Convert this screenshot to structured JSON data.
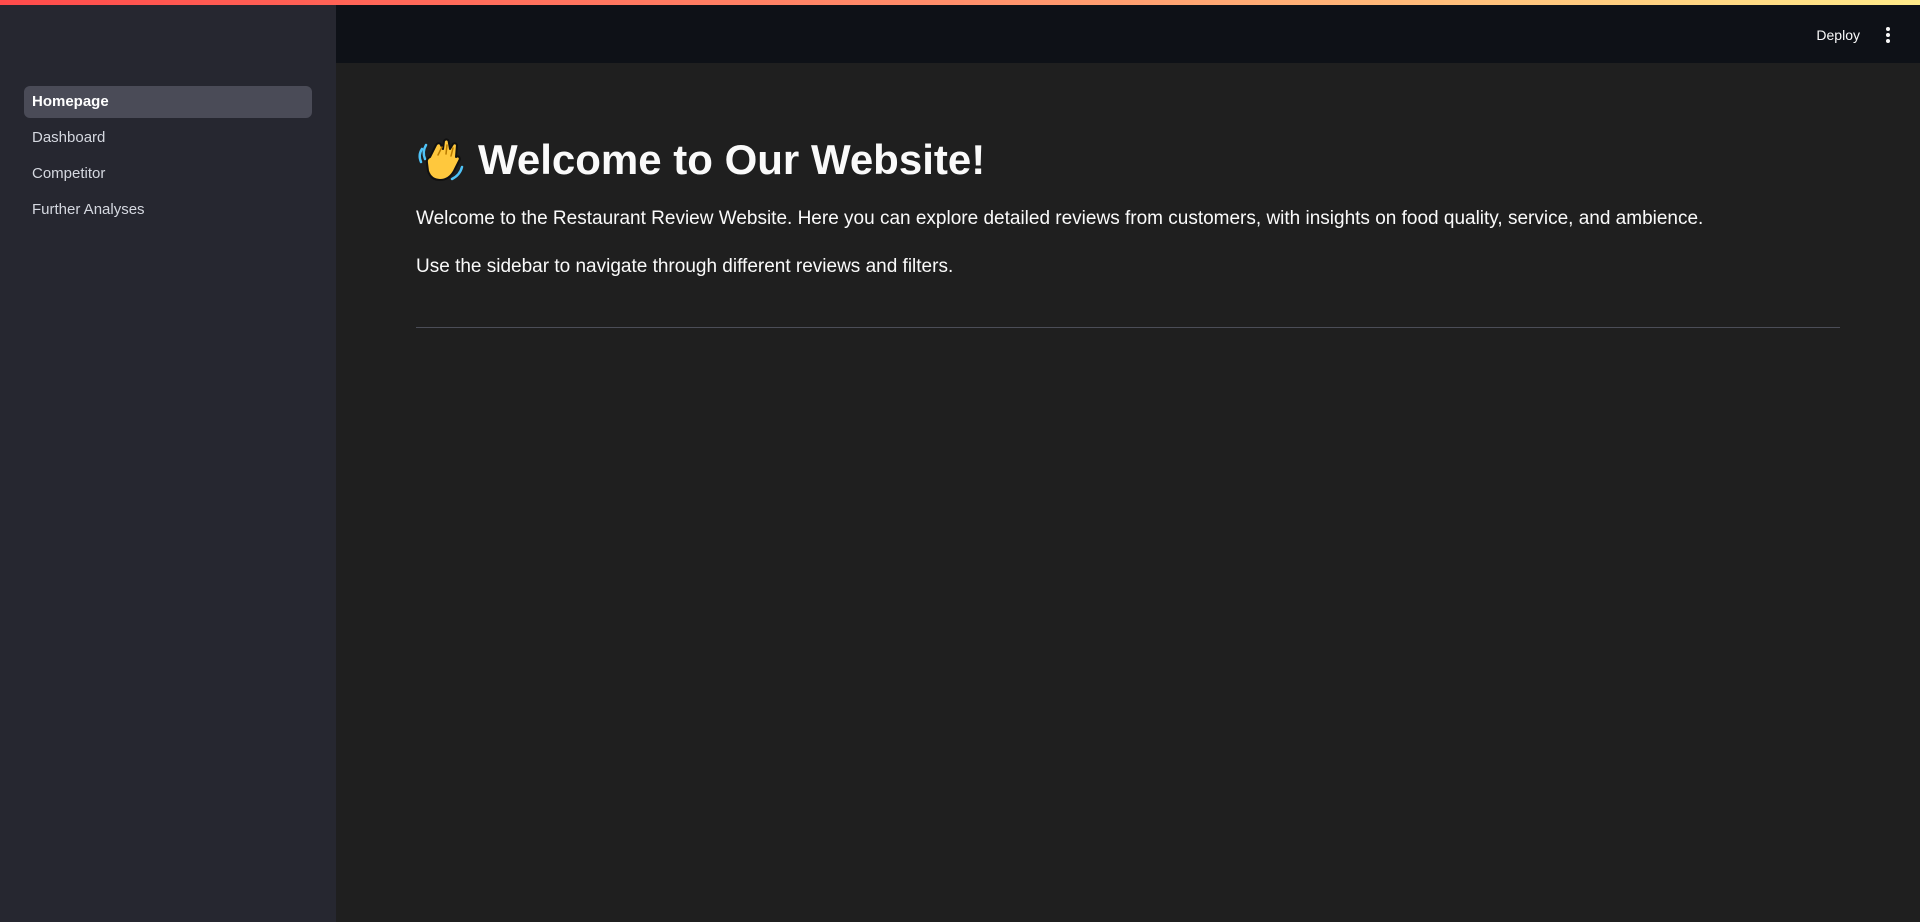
{
  "sidebar": {
    "items": [
      {
        "label": "Homepage",
        "active": true
      },
      {
        "label": "Dashboard",
        "active": false
      },
      {
        "label": "Competitor",
        "active": false
      },
      {
        "label": "Further Analyses",
        "active": false
      }
    ]
  },
  "header": {
    "deploy_label": "Deploy",
    "menu_icon": "vertical-ellipsis-icon"
  },
  "main": {
    "title_icon": "waving-hand-icon",
    "title": "Welcome to Our Website!",
    "paragraph_1": "Welcome to the Restaurant Review Website. Here you can explore detailed reviews from customers, with insights on food quality, service, and ambience.",
    "paragraph_2": "Use the sidebar to navigate through different reviews and filters."
  },
  "colors": {
    "sidebar_bg": "#262730",
    "header_bg": "#0e1117",
    "main_bg": "#1f1f1f",
    "active_item_bg": "#4a4b57",
    "accent_stripe": [
      "#ff4b4b",
      "#ffeb8a"
    ]
  }
}
